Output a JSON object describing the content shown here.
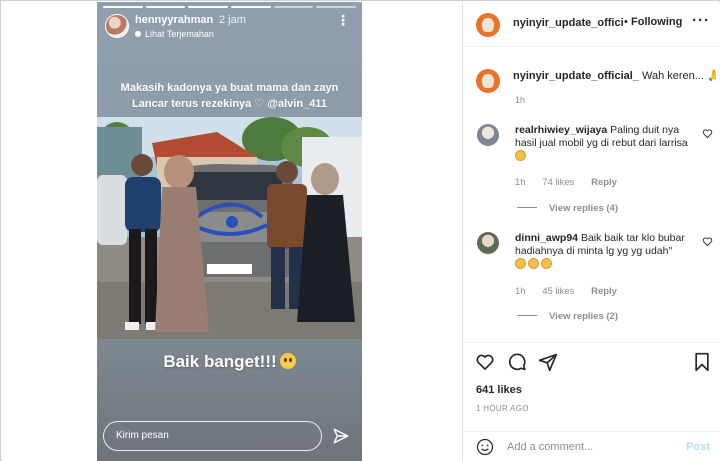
{
  "story": {
    "username": "hennyyrahman",
    "time": "2 jam",
    "translate_label": "Lihat Terjemahan",
    "caption_line1": "Makasih kadonya ya buat mama dan zayn",
    "caption_line2": "Lancar terus rezekinya",
    "caption_mention": "@alvin_411",
    "sticker_text": "Baik banget!!!",
    "reply_placeholder": "Kirim pesan",
    "progress_segments": 6,
    "progress_done": 4
  },
  "post": {
    "author": "nyinyir_update_officia",
    "follow_sep": "•",
    "follow_label": "Following",
    "more_label": "•••",
    "caption_user": "nyinyir_update_official_",
    "caption_text": "Wah keren...",
    "caption_time": "1h",
    "comments": [
      {
        "user": "realrhiwiey_wijaya",
        "text": "Paling duit nya hasil jual mobil yg di rebut dari larrisa",
        "time": "1h",
        "likes": "74 likes",
        "reply_label": "Reply",
        "view_replies": "View replies (4)"
      },
      {
        "user": "dinni_awp94",
        "text": "Baik baik tar klo bubar hadiahnya di minta lg yg yg udah\"",
        "time": "1h",
        "likes": "45 likes",
        "reply_label": "Reply",
        "view_replies": "View replies (2)"
      }
    ],
    "likes_count": "641 likes",
    "time_ago": "1 HOUR AGO",
    "add_comment_placeholder": "Add a comment...",
    "post_button": "Post"
  },
  "colors": {
    "accent_blue": "#b2dffc",
    "avatar_orange": "#e8742c",
    "muted_text": "#8e8e8e"
  }
}
